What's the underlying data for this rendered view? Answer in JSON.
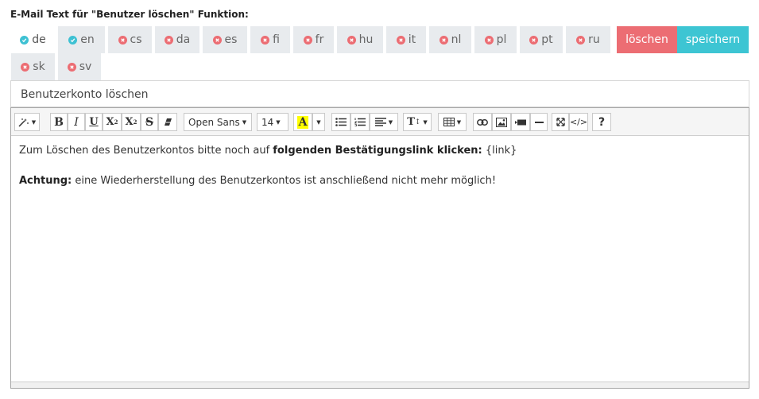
{
  "heading": "E-Mail Text für \"Benutzer löschen\" Funktion:",
  "languages": [
    {
      "code": "de",
      "status": "ok",
      "active": true
    },
    {
      "code": "en",
      "status": "ok"
    },
    {
      "code": "cs",
      "status": "missing"
    },
    {
      "code": "da",
      "status": "missing"
    },
    {
      "code": "es",
      "status": "missing"
    },
    {
      "code": "fi",
      "status": "missing"
    },
    {
      "code": "fr",
      "status": "missing"
    },
    {
      "code": "hu",
      "status": "missing"
    },
    {
      "code": "it",
      "status": "missing"
    },
    {
      "code": "nl",
      "status": "missing"
    },
    {
      "code": "pl",
      "status": "missing"
    },
    {
      "code": "pt",
      "status": "missing"
    },
    {
      "code": "ru",
      "status": "missing"
    },
    {
      "code": "sk",
      "status": "missing"
    },
    {
      "code": "sv",
      "status": "missing"
    }
  ],
  "buttons": {
    "delete": "löschen",
    "save": "speichern"
  },
  "subject": "Benutzerkonto löschen",
  "toolbar": {
    "font_family": "Open Sans",
    "font_size": "14"
  },
  "body": {
    "line1_prefix": "Zum Löschen des Benutzerkontos bitte noch auf ",
    "line1_bold": "folgenden Bestätigungslink klicken:",
    "line1_suffix": " {link}",
    "line2_bold": "Achtung:",
    "line2_rest": " eine Wiederherstellung des Benutzerkontos ist anschließend nicht mehr möglich!"
  },
  "colors": {
    "ok": "#3ec1d3",
    "missing": "#ec6d73",
    "delete": "#ec6d73",
    "save": "#3dc5d3"
  }
}
